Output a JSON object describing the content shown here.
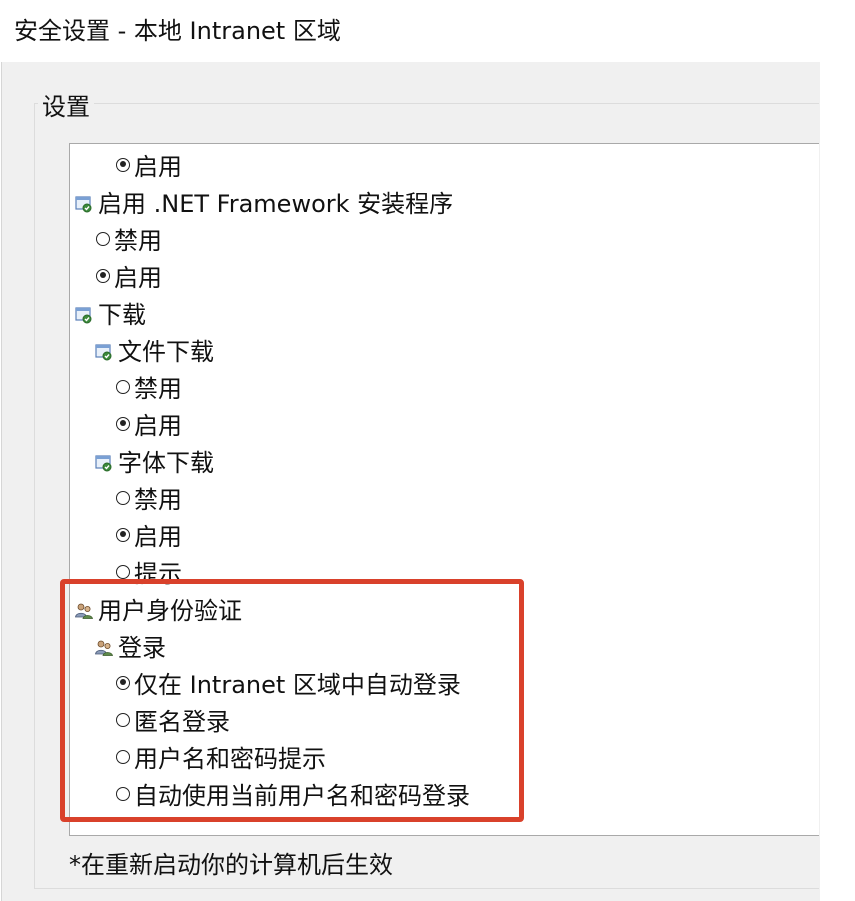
{
  "window": {
    "title": "安全设置 - 本地 Intranet 区域"
  },
  "group": {
    "label": "设置"
  },
  "settings_list": [
    {
      "kind": "option",
      "label": "启用",
      "checked": true
    },
    {
      "kind": "category",
      "label": "启用 .NET Framework 安装程序",
      "icon": "settings-icon"
    },
    {
      "kind": "option",
      "label": "禁用",
      "checked": false
    },
    {
      "kind": "option",
      "label": "启用",
      "checked": true
    },
    {
      "kind": "category",
      "label": "下载",
      "icon": "settings-icon"
    },
    {
      "kind": "category",
      "label": "文件下载",
      "icon": "settings-icon"
    },
    {
      "kind": "option",
      "label": "禁用",
      "checked": false
    },
    {
      "kind": "option",
      "label": "启用",
      "checked": true
    },
    {
      "kind": "category",
      "label": "字体下载",
      "icon": "settings-icon"
    },
    {
      "kind": "option",
      "label": "禁用",
      "checked": false
    },
    {
      "kind": "option",
      "label": "启用",
      "checked": true
    },
    {
      "kind": "option",
      "label": "提示",
      "checked": false
    },
    {
      "kind": "category",
      "label": "用户身份验证",
      "icon": "users-icon"
    },
    {
      "kind": "category",
      "label": "登录",
      "icon": "users-icon"
    },
    {
      "kind": "option",
      "label": "仅在 Intranet 区域中自动登录",
      "checked": true
    },
    {
      "kind": "option",
      "label": "匿名登录",
      "checked": false
    },
    {
      "kind": "option",
      "label": "用户名和密码提示",
      "checked": false
    },
    {
      "kind": "option",
      "label": "自动使用当前用户名和密码登录",
      "checked": false
    }
  ],
  "footer": {
    "note": "*在重新启动你的计算机后生效"
  },
  "colors": {
    "highlight": "#d9412b",
    "dialog_bg": "#f0f0f0",
    "list_bg": "#ffffff"
  }
}
